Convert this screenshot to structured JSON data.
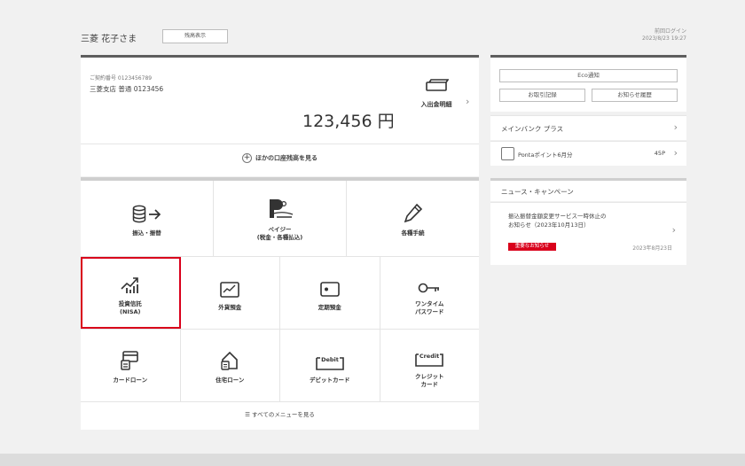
{
  "header": {
    "user_name": "三菱 花子さま",
    "display_button": "残高表示",
    "last_login_label": "前回ログイン",
    "last_login_time": "2023/8/23 19:27"
  },
  "account": {
    "number_line": "ご契約番号 0123456789",
    "branch_line": "三菱支店 普通 0123456",
    "balance": "123,456 円",
    "detail_label": "入出金明細",
    "other_accounts": "ほかの口座残高を見る"
  },
  "menu": {
    "row1": [
      {
        "label": "振込・振替",
        "icon": "transfer-icon"
      },
      {
        "label": "ペイジー\n(税金・各種払込)",
        "icon": "pay-easy-icon"
      },
      {
        "label": "各種手続",
        "icon": "pencil-icon"
      }
    ],
    "row2": [
      {
        "label": "投資信託\n(NISA)",
        "icon": "investment-trust-icon"
      },
      {
        "label": "外貨預金",
        "icon": "foreign-deposit-icon"
      },
      {
        "label": "定期預金",
        "icon": "time-deposit-icon"
      },
      {
        "label": "ワンタイム\nパスワード",
        "icon": "key-icon"
      }
    ],
    "row3": [
      {
        "label": "カードローン",
        "icon": "card-loan-icon"
      },
      {
        "label": "住宅ローン",
        "icon": "housing-loan-icon"
      },
      {
        "label": "デビットカード",
        "icon": "debit-card-icon"
      },
      {
        "label": "クレジット\nカード",
        "icon": "credit-card-icon"
      }
    ],
    "all_menu": "すべてのメニューを見る",
    "debit_tag": "Debit",
    "credit_tag": "Credit"
  },
  "side": {
    "eco_button": "Eco通知",
    "history_button": "お取引記録",
    "notice_button": "お知らせ履歴",
    "main_bank_plus": "メインバンク プラス",
    "ponta_label": "Pontaポイント6月分",
    "ponta_points": "45P",
    "news_title": "ニュース・キャンペーン",
    "news_item_text": "振込振替金額変更サービス一時休止の\nお知らせ（2023年10月13日）",
    "news_item_badge": "重要なお知らせ",
    "news_item_date": "2023年8月23日"
  },
  "colors": {
    "accent_red": "#d9001b",
    "header_bar": "#5e5e5e"
  }
}
